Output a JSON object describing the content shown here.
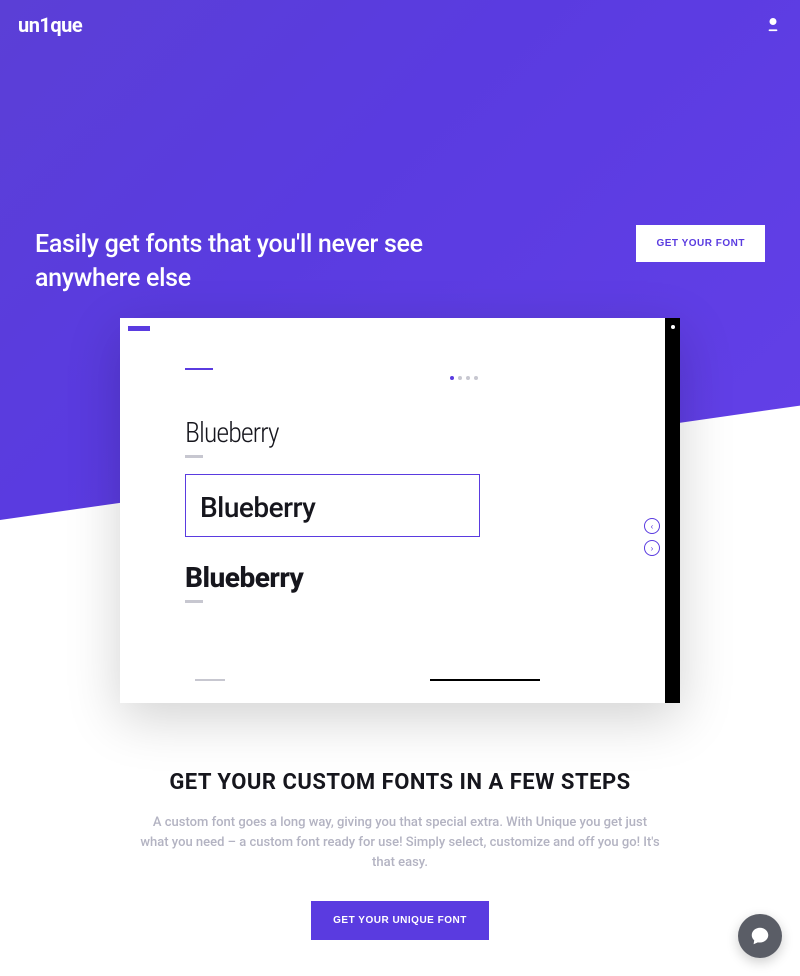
{
  "brand": "un1que",
  "hero": {
    "headline": "Easily get fonts that you'll never see anywhere else",
    "cta_label": "GET YOUR FONT"
  },
  "preview": {
    "sample_word": "Blueberry",
    "samples": [
      {
        "word": "Blueberry"
      },
      {
        "word": "Blueberry"
      },
      {
        "word": "Blueberry"
      }
    ],
    "pager_active_index": 0,
    "pager_count": 4
  },
  "steps": {
    "title": "GET YOUR CUSTOM FONTS IN A FEW STEPS",
    "description": "A custom font goes a long way, giving you that special extra. With Unique you get just what you need – a custom font ready for use! Simply select, customize and off you go! It's that easy.",
    "cta_label": "GET YOUR UNIQUE FONT"
  },
  "icons": {
    "account": "account-icon",
    "chat": "chat-icon",
    "prev": "chevron-left-icon",
    "next": "chevron-right-icon"
  },
  "colors": {
    "accent": "#5a3be0",
    "text_dark": "#16161d",
    "text_muted": "#b3b3c2"
  }
}
